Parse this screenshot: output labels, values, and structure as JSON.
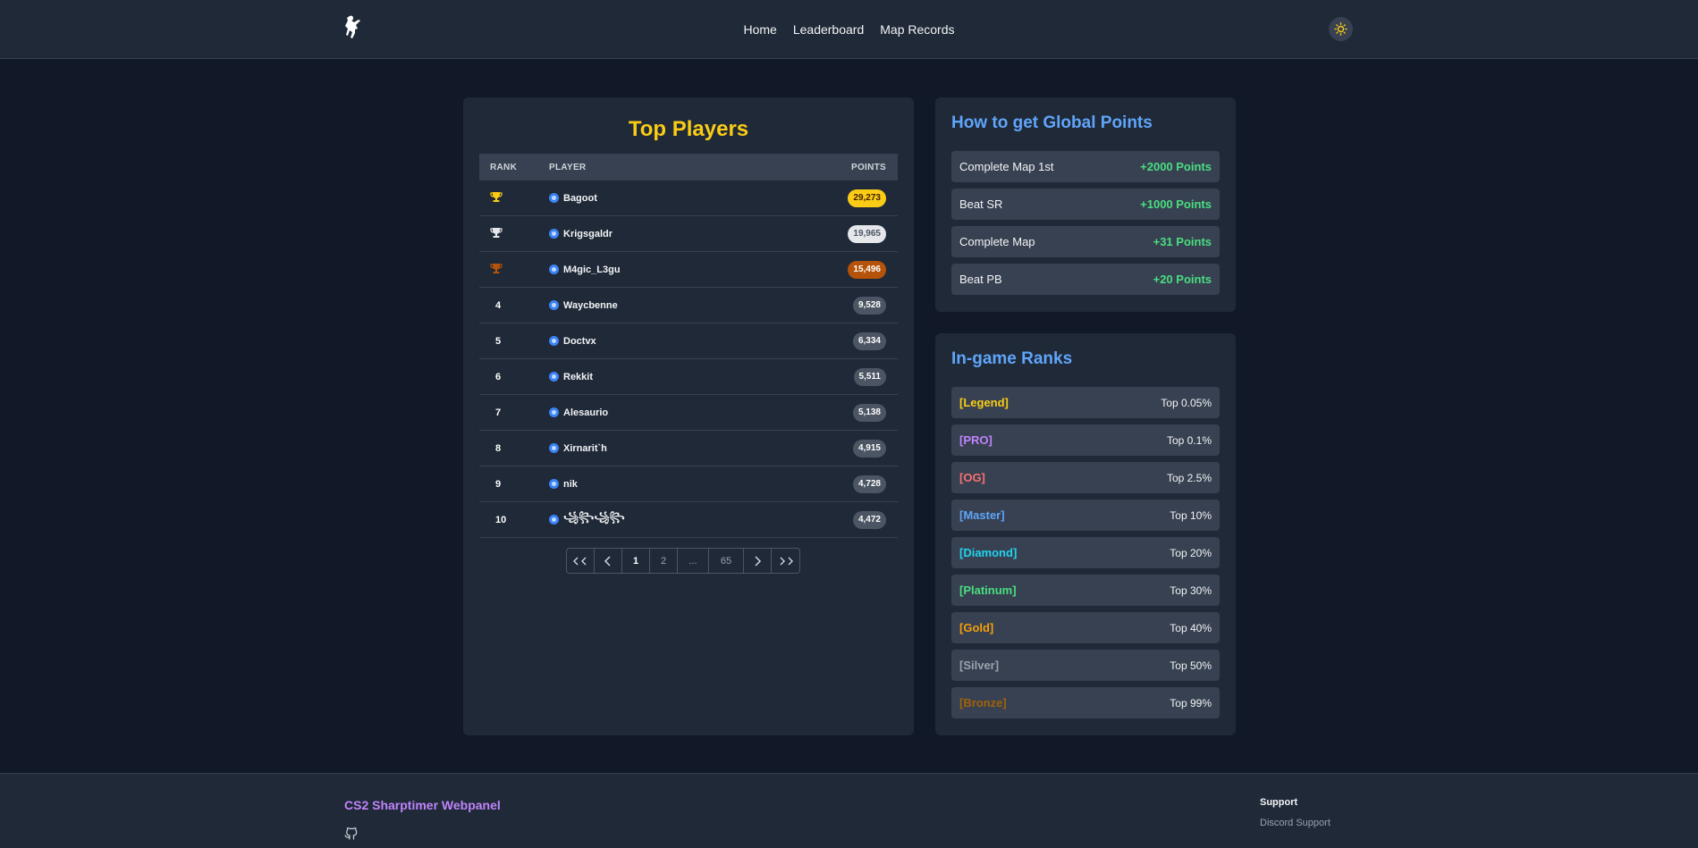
{
  "nav": {
    "items": [
      "Home",
      "Leaderboard",
      "Map Records"
    ]
  },
  "colors": {
    "accent_gold": "#facc15",
    "accent_blue": "#60a5fa",
    "accent_green": "#4ade80",
    "brand_purple": "#c084fc",
    "page_bg": "#111827",
    "card_bg": "#1f2937"
  },
  "leaderboard": {
    "title": "Top Players",
    "columns": {
      "rank": "RANK",
      "player": "PLAYER",
      "points": "POINTS"
    },
    "rows": [
      {
        "rank": "",
        "rank_icon": "trophy-gold-icon",
        "player": "Bagoot",
        "points": "29,273",
        "tier": "gold"
      },
      {
        "rank": "",
        "rank_icon": "trophy-silver-icon",
        "player": "Krigsgaldr",
        "points": "19,965",
        "tier": "silver"
      },
      {
        "rank": "",
        "rank_icon": "trophy-bronze-icon",
        "player": "M4gic_L3gu",
        "points": "15,496",
        "tier": "bronze"
      },
      {
        "rank": "4",
        "player": "Waycbenne",
        "points": "9,528",
        "tier": "normal"
      },
      {
        "rank": "5",
        "player": "Doctvx",
        "points": "6,334",
        "tier": "normal"
      },
      {
        "rank": "6",
        "player": "Rekkit",
        "points": "5,511",
        "tier": "normal"
      },
      {
        "rank": "7",
        "player": "Alesaurio",
        "points": "5,138",
        "tier": "normal"
      },
      {
        "rank": "8",
        "player": "Xirnarit`h",
        "points": "4,915",
        "tier": "normal"
      },
      {
        "rank": "9",
        "player": "nik",
        "points": "4,728",
        "tier": "normal"
      },
      {
        "rank": "10",
        "player": "꧁꧂꧁꧂",
        "points": "4,472",
        "tier": "normal"
      }
    ],
    "pagination": {
      "first": "first-page-icon",
      "prev": "prev-page-icon",
      "pages": [
        "1",
        "2",
        "...",
        "65"
      ],
      "active": "1",
      "next": "next-page-icon",
      "last": "last-page-icon"
    }
  },
  "global_points": {
    "title": "How to get Global Points",
    "items": [
      {
        "label": "Complete Map 1st",
        "value": "+2000 Points"
      },
      {
        "label": "Beat SR",
        "value": "+1000 Points"
      },
      {
        "label": "Complete Map",
        "value": "+31 Points"
      },
      {
        "label": "Beat PB",
        "value": "+20 Points"
      }
    ]
  },
  "ingame_ranks": {
    "title": "In-game Ranks",
    "items": [
      {
        "label": "[Legend]",
        "value": "Top 0.05%",
        "color": "#facc15"
      },
      {
        "label": "[PRO]",
        "value": "Top 0.1%",
        "color": "#c084fc"
      },
      {
        "label": "[OG]",
        "value": "Top 2.5%",
        "color": "#f87171"
      },
      {
        "label": "[Master]",
        "value": "Top 10%",
        "color": "#60a5fa"
      },
      {
        "label": "[Diamond]",
        "value": "Top 20%",
        "color": "#22d3ee"
      },
      {
        "label": "[Platinum]",
        "value": "Top 30%",
        "color": "#4ade80"
      },
      {
        "label": "[Gold]",
        "value": "Top 40%",
        "color": "#f59e0b"
      },
      {
        "label": "[Silver]",
        "value": "Top 50%",
        "color": "#9ca3af"
      },
      {
        "label": "[Bronze]",
        "value": "Top 99%",
        "color": "#a16207"
      }
    ]
  },
  "footer": {
    "brand": "CS2 Sharptimer Webpanel",
    "support_heading": "Support",
    "support_link": "Discord Support"
  }
}
